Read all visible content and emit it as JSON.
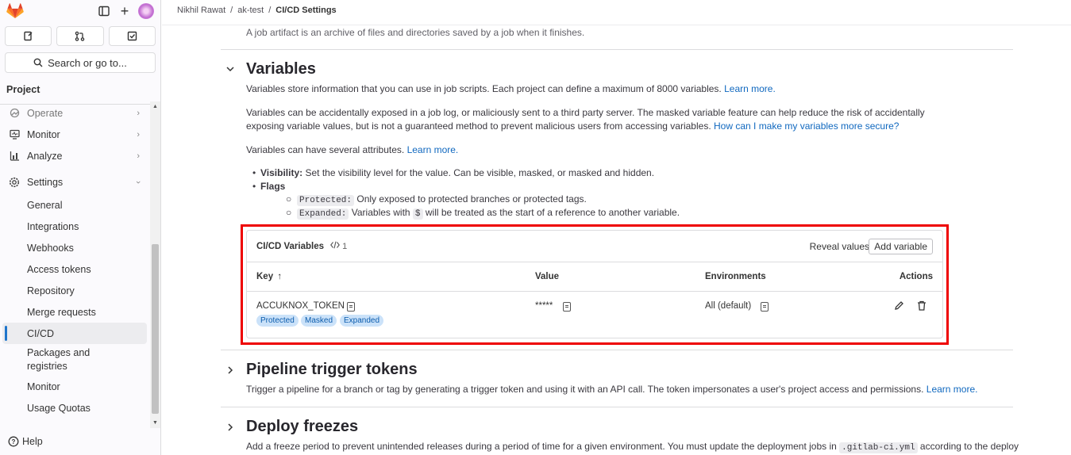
{
  "sidebar": {
    "search_label": "Search or go to...",
    "section_title": "Project",
    "items": [
      {
        "label": "Operate",
        "icon": "operate-icon"
      },
      {
        "label": "Monitor",
        "icon": "monitor-icon"
      },
      {
        "label": "Analyze",
        "icon": "analyze-icon"
      },
      {
        "label": "Settings",
        "icon": "settings-icon"
      }
    ],
    "sub_items": [
      "General",
      "Integrations",
      "Webhooks",
      "Access tokens",
      "Repository",
      "Merge requests",
      "CI/CD",
      "Packages and registries",
      "Monitor",
      "Usage Quotas"
    ],
    "help_label": "Help"
  },
  "breadcrumb": {
    "user": "Nikhil Rawat",
    "sep": "/",
    "project": "ak-test",
    "current": "CI/CD Settings"
  },
  "artifact_text": "A job artifact is an archive of files and directories saved by a job when it finishes.",
  "variables": {
    "title": "Variables",
    "intro": "Variables store information that you can use in job scripts. Each project can define a maximum of 8000 variables.",
    "intro_link": "Learn more.",
    "warn_line1": "Variables can be accidentally exposed in a job log, or maliciously sent to a third party server. The masked variable feature can help reduce the risk of accidentally",
    "warn_line2": "exposing variable values, but is not a guaranteed method to prevent malicious users from accessing variables.",
    "warn_link": "How can I make my variables more secure?",
    "attrs": "Variables can have several attributes.",
    "attrs_link": "Learn more.",
    "visibility_label": "Visibility:",
    "visibility_text": "Set the visibility level for the value. Can be visible, masked, or masked and hidden.",
    "flags_label": "Flags",
    "protected_code": "Protected:",
    "protected_text": "Only exposed to protected branches or protected tags.",
    "expanded_code": "Expanded:",
    "expanded_text1": "Variables with",
    "expanded_dollar": "$",
    "expanded_text2": "will be treated as the start of a reference to another variable."
  },
  "cicd_card": {
    "title": "CI/CD Variables",
    "count": "1",
    "reveal": "Reveal values",
    "add": "Add variable",
    "headers": {
      "key": "Key",
      "sort": "↑",
      "value": "Value",
      "env": "Environments",
      "actions": "Actions"
    },
    "row": {
      "key": "ACCUKNOX_TOKEN",
      "value": "*****",
      "env": "All (default)",
      "badges": [
        "Protected",
        "Masked",
        "Expanded"
      ]
    }
  },
  "pipeline": {
    "title": "Pipeline trigger tokens",
    "text": "Trigger a pipeline for a branch or tag by generating a trigger token and using it with an API call. The token impersonates a user's project access and permissions.",
    "link": "Learn more."
  },
  "deploy": {
    "title": "Deploy freezes",
    "text": "Add a freeze period to prevent unintended releases during a period of time for a given environment. You must update the deployment jobs in",
    "code": ".gitlab-ci.yml",
    "text2": "according to the deploy"
  },
  "colors": {
    "accent": "#1f75cb",
    "link": "#1068bf",
    "highlight": "#ee0000",
    "badge_bg": "#cbe2f9"
  }
}
